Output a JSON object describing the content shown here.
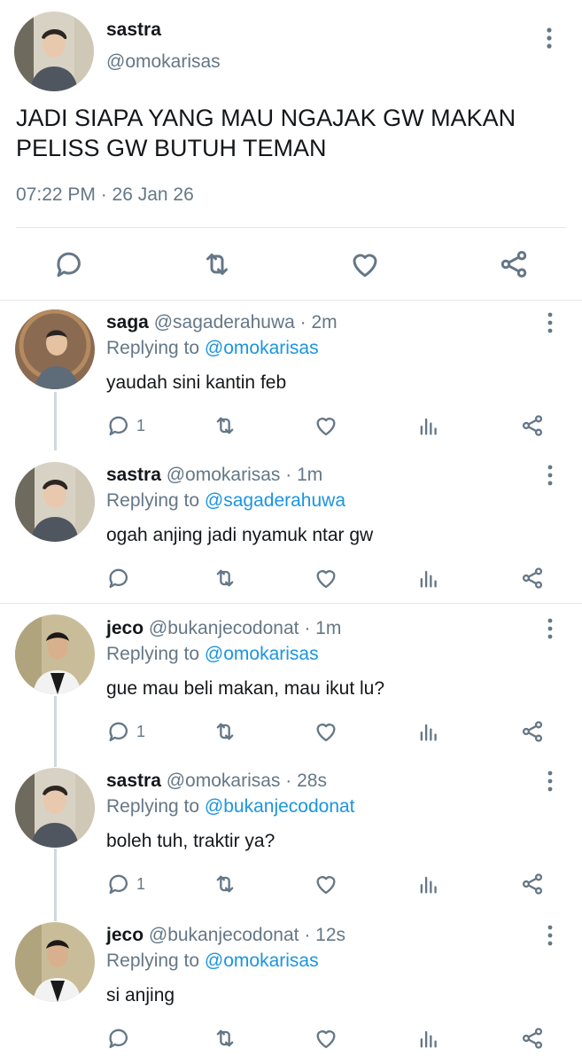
{
  "main_tweet": {
    "name": "sastra",
    "handle": "@omokarisas",
    "text_line1": "JADI SIAPA YANG MAU NGAJAK GW MAKAN",
    "text_line2": "PELISS GW BUTUH TEMAN",
    "timestamp": "07:22 PM · 26 Jan 26",
    "icons": [
      "reply-icon",
      "retweet-icon",
      "like-icon",
      "share-icon"
    ]
  },
  "replies": [
    {
      "name": "saga",
      "meta": "@sagaderahuwa · 2m",
      "replying_prefix": "Replying to ",
      "replying_to": "@omokarisas",
      "text": "yaudah sini kantin feb",
      "reply_count": "1"
    },
    {
      "name": "sastra",
      "meta": "@omokarisas · 1m",
      "replying_prefix": "Replying to ",
      "replying_to": "@sagaderahuwa",
      "text": "ogah anjing jadi nyamuk ntar gw",
      "reply_count": ""
    },
    {
      "name": "jeco",
      "meta": "@bukanjecodonat · 1m",
      "replying_prefix": "Replying to ",
      "replying_to": "@omokarisas",
      "text": "gue mau beli makan, mau ikut lu?",
      "reply_count": "1"
    },
    {
      "name": "sastra",
      "meta": "@omokarisas · 28s",
      "replying_prefix": "Replying to ",
      "replying_to": "@bukanjecodonat",
      "text": "boleh tuh, traktir ya?",
      "reply_count": "1"
    },
    {
      "name": "jeco",
      "meta": "@bukanjecodonat · 12s",
      "replying_prefix": "Replying to ",
      "replying_to": "@omokarisas",
      "text": "si anjing",
      "reply_count": ""
    }
  ],
  "colors": {
    "text": "#14171a",
    "secondary": "#657786",
    "mention": "#1b95e0",
    "divider": "#e1e6ea"
  }
}
